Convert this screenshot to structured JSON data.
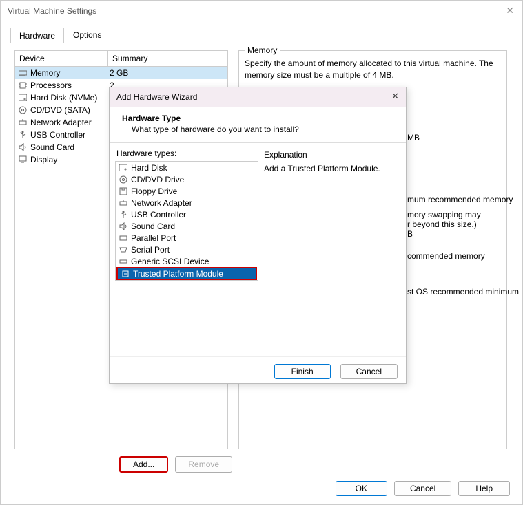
{
  "main": {
    "title": "Virtual Machine Settings",
    "tabs": [
      "Hardware",
      "Options"
    ],
    "activeTab": 0,
    "deviceHeader": {
      "device": "Device",
      "summary": "Summary"
    },
    "devices": [
      {
        "icon": "memory-icon",
        "name": "Memory",
        "summary": "2 GB",
        "selected": true
      },
      {
        "icon": "cpu-icon",
        "name": "Processors",
        "summary": "2"
      },
      {
        "icon": "disk-icon",
        "name": "Hard Disk (NVMe)",
        "summary": ""
      },
      {
        "icon": "cd-icon",
        "name": "CD/DVD (SATA)",
        "summary": ""
      },
      {
        "icon": "network-icon",
        "name": "Network Adapter",
        "summary": ""
      },
      {
        "icon": "usb-icon",
        "name": "USB Controller",
        "summary": ""
      },
      {
        "icon": "sound-icon",
        "name": "Sound Card",
        "summary": ""
      },
      {
        "icon": "display-icon",
        "name": "Display",
        "summary": ""
      }
    ],
    "rightPanel": {
      "groupLabel": "Memory",
      "desc": "Specify the amount of memory allocated to this virtual machine. The memory size must be a multiple of 4 MB.",
      "hints": [
        "MB",
        "mum recommended memory",
        "mory swapping may\nr beyond this size.)",
        "B",
        "commended memory",
        "st OS recommended minimum"
      ]
    },
    "buttons": {
      "add": "Add...",
      "remove": "Remove",
      "ok": "OK",
      "cancel": "Cancel",
      "help": "Help"
    }
  },
  "wizard": {
    "title": "Add Hardware Wizard",
    "header": {
      "title": "Hardware Type",
      "sub": "What type of hardware do you want to install?"
    },
    "listLabel": "Hardware types:",
    "explLabel": "Explanation",
    "explText": "Add a Trusted Platform Module.",
    "items": [
      {
        "icon": "disk-icon",
        "name": "Hard Disk"
      },
      {
        "icon": "cd-icon",
        "name": "CD/DVD Drive"
      },
      {
        "icon": "floppy-icon",
        "name": "Floppy Drive"
      },
      {
        "icon": "network-icon",
        "name": "Network Adapter"
      },
      {
        "icon": "usb-icon",
        "name": "USB Controller"
      },
      {
        "icon": "sound-icon",
        "name": "Sound Card"
      },
      {
        "icon": "parallel-icon",
        "name": "Parallel Port"
      },
      {
        "icon": "serial-icon",
        "name": "Serial Port"
      },
      {
        "icon": "scsi-icon",
        "name": "Generic SCSI Device"
      },
      {
        "icon": "tpm-icon",
        "name": "Trusted Platform Module",
        "selected": true
      }
    ],
    "buttons": {
      "finish": "Finish",
      "cancel": "Cancel"
    }
  }
}
